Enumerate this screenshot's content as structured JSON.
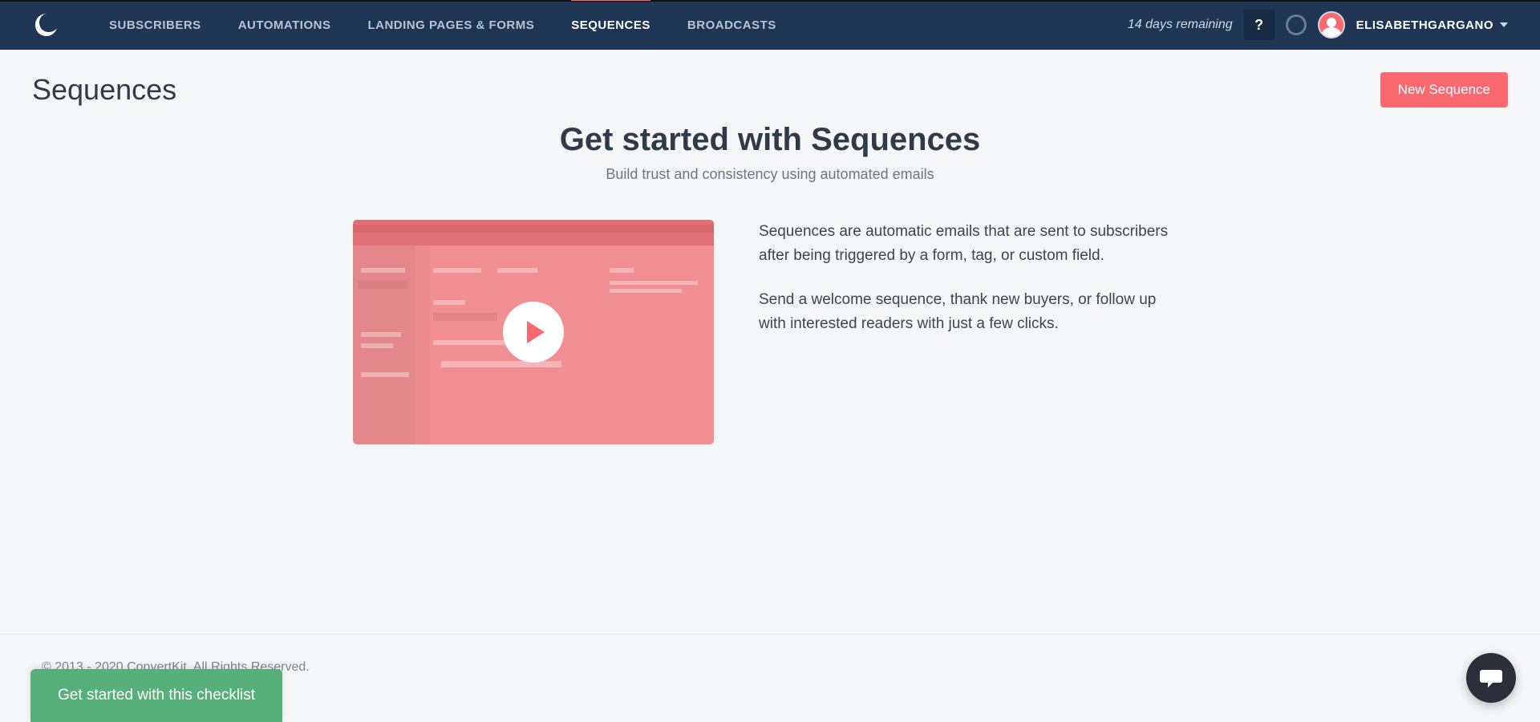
{
  "nav": {
    "items": [
      "SUBSCRIBERS",
      "AUTOMATIONS",
      "LANDING PAGES & FORMS",
      "SEQUENCES",
      "BROADCASTS"
    ],
    "active_index": 3
  },
  "account": {
    "trial_text": "14 days remaining",
    "help_label": "?",
    "username": "ELISABETHGARGANO"
  },
  "page": {
    "title": "Sequences",
    "new_button": "New Sequence"
  },
  "hero": {
    "title": "Get started with Sequences",
    "subtitle": "Build trust and consistency using automated emails",
    "paragraph1": "Sequences are automatic emails that are sent to subscribers after being triggered by a form, tag, or custom field.",
    "paragraph2": "Send a welcome sequence, thank new buyers, or follow up with interested readers with just a few clicks."
  },
  "footer": {
    "copyright": "© 2013 - 2020 ConvertKit. All Rights Reserved."
  },
  "checklist": {
    "label": "Get started with this checklist"
  }
}
